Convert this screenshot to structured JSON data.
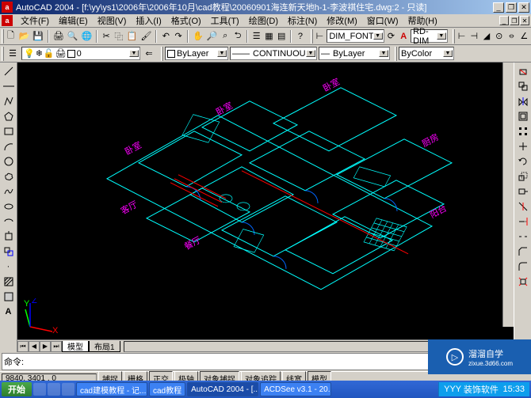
{
  "title_bar": {
    "app_icon_letter": "a",
    "title": "AutoCAD 2004 - [f:\\yy\\ys1\\2006年\\2006年10月\\cad教程\\20060901海连新天地h-1-李波祺住宅.dwg:2 - 只读]"
  },
  "menu": {
    "items": [
      "文件(F)",
      "编辑(E)",
      "视图(V)",
      "插入(I)",
      "格式(O)",
      "工具(T)",
      "绘图(D)",
      "标注(N)",
      "修改(M)",
      "窗口(W)",
      "帮助(H)"
    ]
  },
  "toolbar1": {
    "dim_font": "DIM_FONT",
    "rd_dim": "RD-DIM"
  },
  "toolbar2": {
    "layer": "ByLayer",
    "linetype": "CONTINUOUS",
    "lineweight": "ByLayer",
    "color": "ByColor"
  },
  "tabs": {
    "model": "模型",
    "layout1": "布局1"
  },
  "command": {
    "prompt": "命令:"
  },
  "status": {
    "coords": "9840, 3401 , 0",
    "buttons": [
      "捕捉",
      "栅格",
      "正交",
      "极轴",
      "对象捕捉",
      "对象追踪",
      "线宽",
      "模型"
    ]
  },
  "taskbar": {
    "start": "开始",
    "tasks": [
      "cad建模教程 - 记...",
      "cad教程",
      "AutoCAD 2004 - [...",
      "ACDSee v3.1 - 20..."
    ],
    "tray_text": "YYY",
    "tray_app": "装饰软件",
    "clock": "15:33"
  },
  "watermark": {
    "main": "溜溜自学",
    "sub": "zixue.3d66.com"
  },
  "ucs": {
    "x": "X",
    "y": "Y",
    "z": "Z"
  }
}
